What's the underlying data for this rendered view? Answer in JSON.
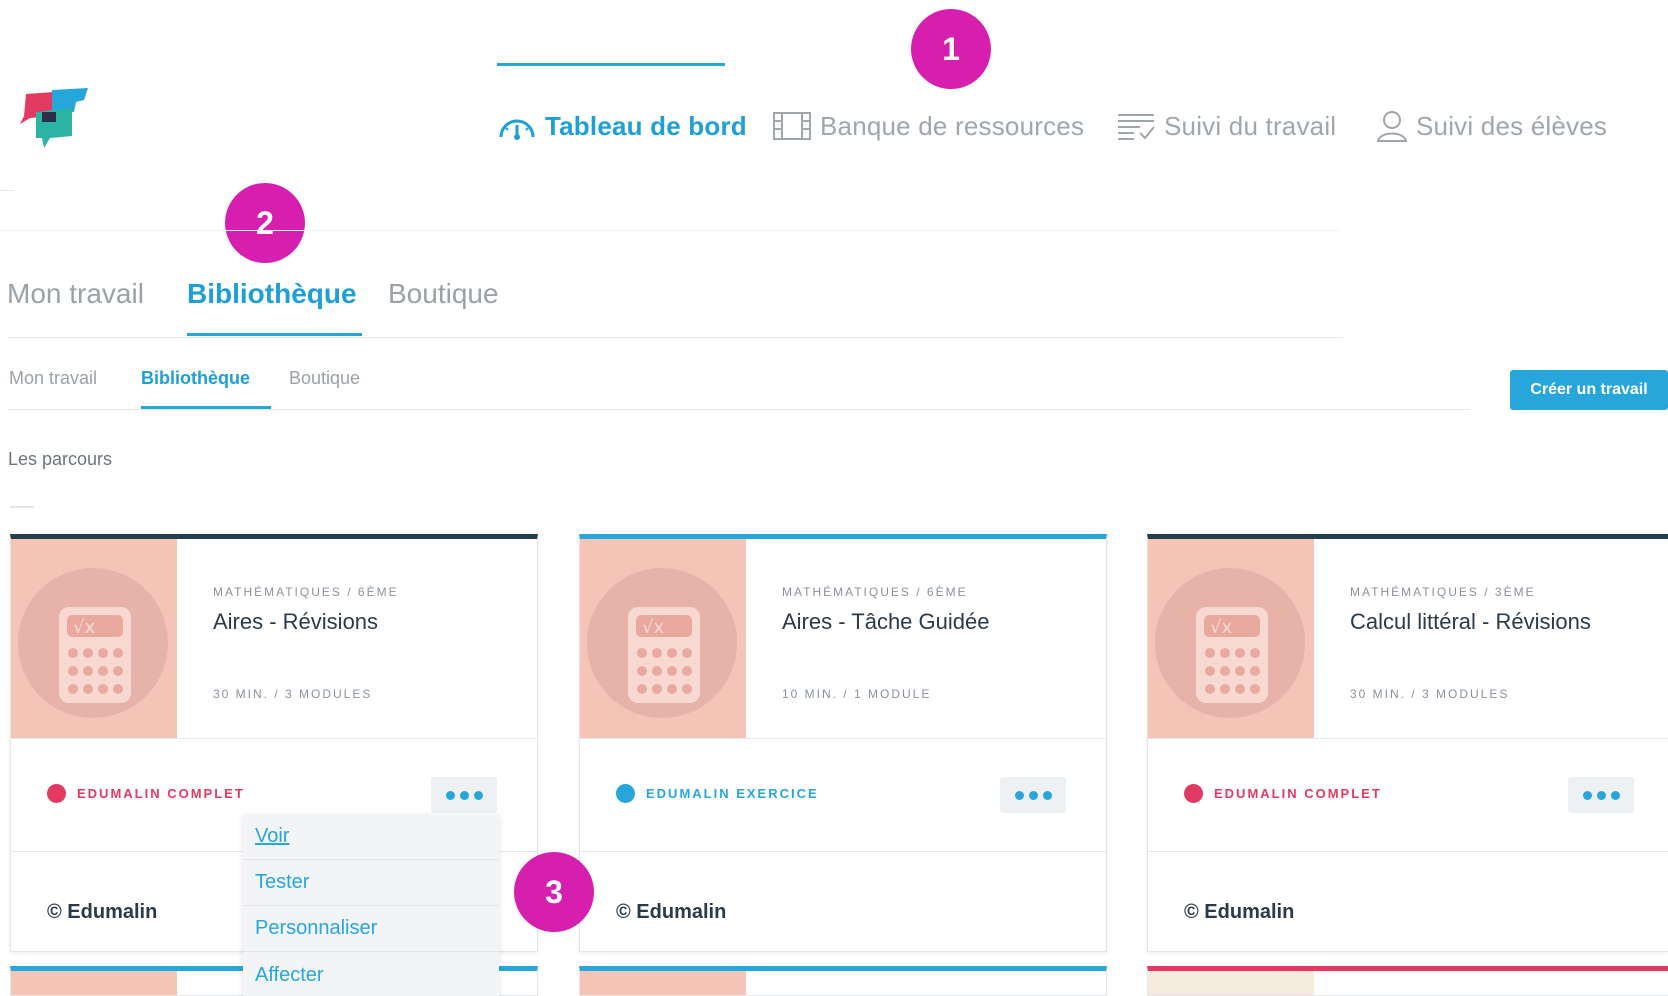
{
  "colors": {
    "accent": "#27a6dc",
    "badge": "#d61fae",
    "complet": "#e23a63",
    "exercice": "#27a6dc",
    "card_top_dark": "#23404f",
    "thumb": "#f4c4b7"
  },
  "logo": {
    "icon": "speech-bubbles-logo"
  },
  "top_nav": {
    "items": [
      {
        "label": "Tableau de bord",
        "icon": "dashboard-gauge-icon",
        "active": true
      },
      {
        "label": "Banque de ressources",
        "icon": "film-grid-icon",
        "active": false
      },
      {
        "label": "Suivi du travail",
        "icon": "list-check-icon",
        "active": false
      },
      {
        "label": "Suivi des élèves",
        "icon": "user-icon",
        "active": false
      }
    ]
  },
  "callouts": [
    "1",
    "2",
    "3"
  ],
  "big_tabs": [
    "Mon travail",
    "Bibliothèque",
    "Boutique"
  ],
  "small_tabs": [
    "Mon travail",
    "Bibliothèque",
    "Boutique"
  ],
  "active_tab": "Bibliothèque",
  "create_button": "Créer un travail",
  "section_title": "Les parcours",
  "cards": [
    {
      "subject": "MATHÉMATIQUES / 6ÈME",
      "title": "Aires - Révisions",
      "meta": "30 MIN. / 3 MODULES",
      "status": "EDUMALIN COMPLET",
      "status_color": "#e23a63",
      "author": "© Edumalin",
      "icon": "calculator-icon"
    },
    {
      "subject": "MATHÉMATIQUES / 6ÈME",
      "title": "Aires - Tâche Guidée",
      "meta": "10 MIN. / 1 MODULE",
      "status": "EDUMALIN EXERCICE",
      "status_color": "#27a6dc",
      "author": "© Edumalin",
      "icon": "calculator-icon"
    },
    {
      "subject": "MATHÉMATIQUES / 3ÈME",
      "title": "Calcul littéral - Révisions",
      "meta": "30 MIN. / 3 MODULES",
      "status": "EDUMALIN COMPLET",
      "status_color": "#e23a63",
      "author": "© Edumalin",
      "icon": "calculator-icon"
    }
  ],
  "dropdown": {
    "items": [
      "Voir",
      "Tester",
      "Personnaliser",
      "Affecter"
    ]
  }
}
